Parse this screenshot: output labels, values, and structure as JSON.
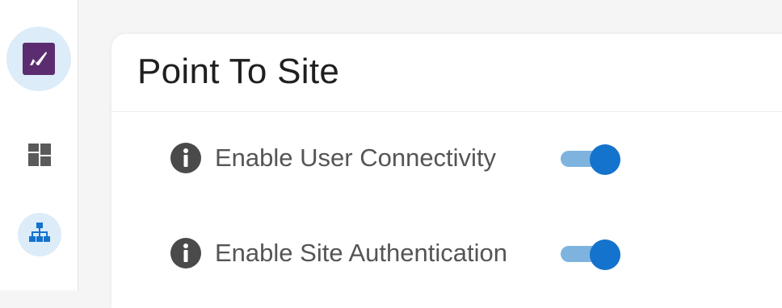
{
  "sidebar": {
    "logo_icon": "brand-logo-icon",
    "items": [
      {
        "icon": "dashboard-icon"
      },
      {
        "icon": "sitemap-icon",
        "active": true
      }
    ]
  },
  "page": {
    "title": "Point To Site"
  },
  "settings": [
    {
      "label": "Enable User Connectivity",
      "enabled": true,
      "icon": "info-icon"
    },
    {
      "label": "Enable Site Authentication",
      "enabled": true,
      "icon": "info-icon"
    }
  ],
  "colors": {
    "brand": "#5b2c6f",
    "accent": "#1473cc",
    "toggle_track": "#7db3de",
    "active_bg": "#dcecf9"
  }
}
